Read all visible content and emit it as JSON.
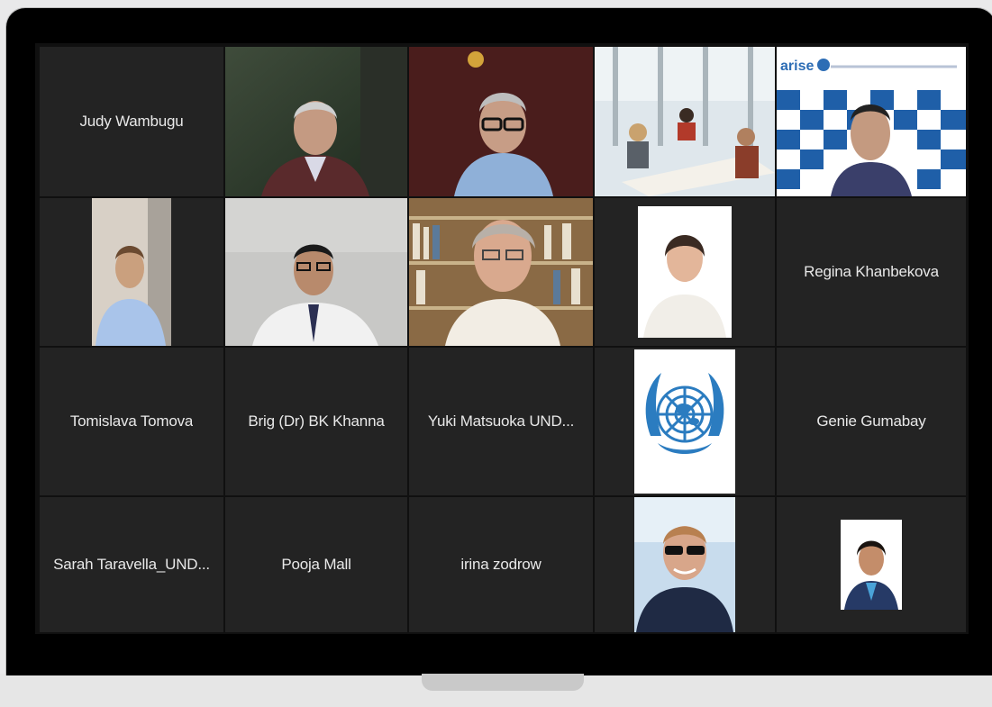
{
  "participants": [
    {
      "name": "Judy Wambugu",
      "type": "name-only"
    },
    {
      "type": "video",
      "icon": "participant-video-1"
    },
    {
      "type": "video",
      "icon": "participant-video-2",
      "active": true
    },
    {
      "type": "video",
      "icon": "participant-video-office"
    },
    {
      "type": "video",
      "icon": "participant-video-arise",
      "backdrop_text": "arise"
    },
    {
      "type": "photo",
      "icon": "participant-photo-1"
    },
    {
      "type": "video",
      "icon": "participant-video-3"
    },
    {
      "type": "video",
      "icon": "participant-video-bookshelf"
    },
    {
      "type": "photo",
      "icon": "participant-photo-2"
    },
    {
      "name": "Regina Khanbekova",
      "type": "name-only"
    },
    {
      "name": "Tomislava Tomova",
      "type": "name-only"
    },
    {
      "name": "Brig (Dr) BK Khanna",
      "type": "name-only"
    },
    {
      "name": "Yuki Matsuoka UND...",
      "type": "name-only"
    },
    {
      "type": "logo",
      "icon": "un-emblem-icon"
    },
    {
      "name": "Genie Gumabay",
      "type": "name-only"
    },
    {
      "name": "Sarah Taravella_UND...",
      "type": "name-only"
    },
    {
      "name": "Pooja Mall",
      "type": "name-only"
    },
    {
      "name": "irina zodrow",
      "type": "name-only"
    },
    {
      "type": "photo",
      "icon": "participant-photo-3"
    },
    {
      "type": "photo",
      "icon": "participant-photo-4"
    }
  ],
  "colors": {
    "tile_bg": "#232323",
    "active_border": "#b7c25a",
    "name_text": "#e8e8e8"
  }
}
